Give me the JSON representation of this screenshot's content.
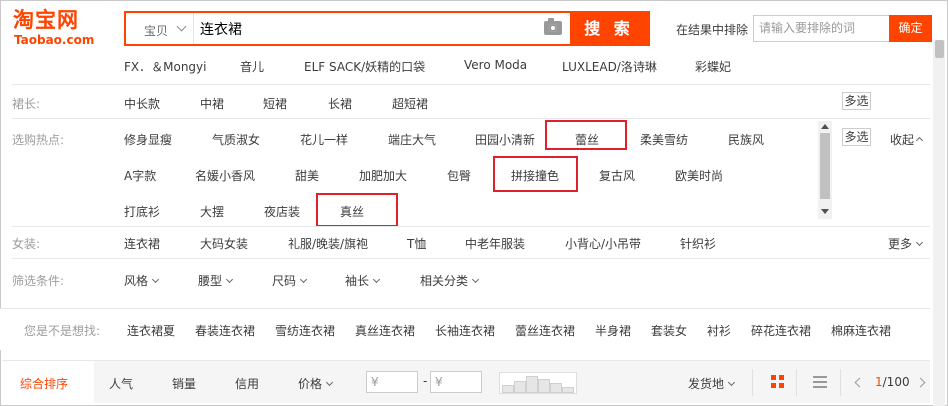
{
  "header": {
    "logo_cn": "淘宝网",
    "logo_en": "Taobao.com",
    "search_type": "宝贝",
    "search_query": "连衣裙",
    "search_button": "搜 索",
    "exclude_label": "在结果中排除",
    "exclude_placeholder": "请输入要排除的词",
    "exclude_button": "确定"
  },
  "brands": [
    "FX．＆Mongyi",
    "音儿",
    "ELF SACK/妖精的口袋",
    "Vero Moda",
    "LUXLEAD/洛诗琳",
    "彩蝶妃"
  ],
  "skirt_length": {
    "label": "裙长:",
    "values": [
      "中长款",
      "中裙",
      "短裙",
      "长裙",
      "超短裙"
    ],
    "multi": "多选"
  },
  "hot_picks": {
    "label": "选购热点:",
    "row1": [
      "修身显瘦",
      "气质淑女",
      "花儿一样",
      "端庄大气",
      "田园小清新",
      "蕾丝",
      "柔美雪纺",
      "民族风"
    ],
    "row2": [
      "A字款",
      "名媛小香风",
      "甜美",
      "加肥加大",
      "包臀",
      "拼接撞色",
      "复古风",
      "欧美时尚"
    ],
    "row3": [
      "打底衫",
      "大摆",
      "夜店装",
      "真丝"
    ],
    "multi": "多选",
    "collapse": "收起"
  },
  "womenswear": {
    "label": "女装:",
    "values": [
      "连衣裙",
      "大码女装",
      "礼服/晚装/旗袍",
      "T恤",
      "中老年服装",
      "小背心/小吊带",
      "针织衫"
    ],
    "more": "更多"
  },
  "filters": {
    "label": "筛选条件:",
    "items": [
      "风格",
      "腰型",
      "尺码",
      "袖长",
      "相关分类"
    ]
  },
  "suggestions": {
    "label": "您是不是想找:",
    "items": [
      "连衣裙夏",
      "春装连衣裙",
      "雪纺连衣裙",
      "真丝连衣裙",
      "长袖连衣裙",
      "蕾丝连衣裙",
      "半身裙",
      "套装女",
      "衬衫",
      "碎花连衣裙",
      "棉麻连衣裙"
    ]
  },
  "sort": {
    "items": [
      "综合排序",
      "人气",
      "销量",
      "信用",
      "价格"
    ],
    "price_min": "¥",
    "price_max": "¥",
    "price_sep": "-",
    "location": "发货地",
    "page_current": "1",
    "page_total": "/100"
  },
  "colors": {
    "accent": "#ff4400",
    "highlight": "#e0202a"
  }
}
